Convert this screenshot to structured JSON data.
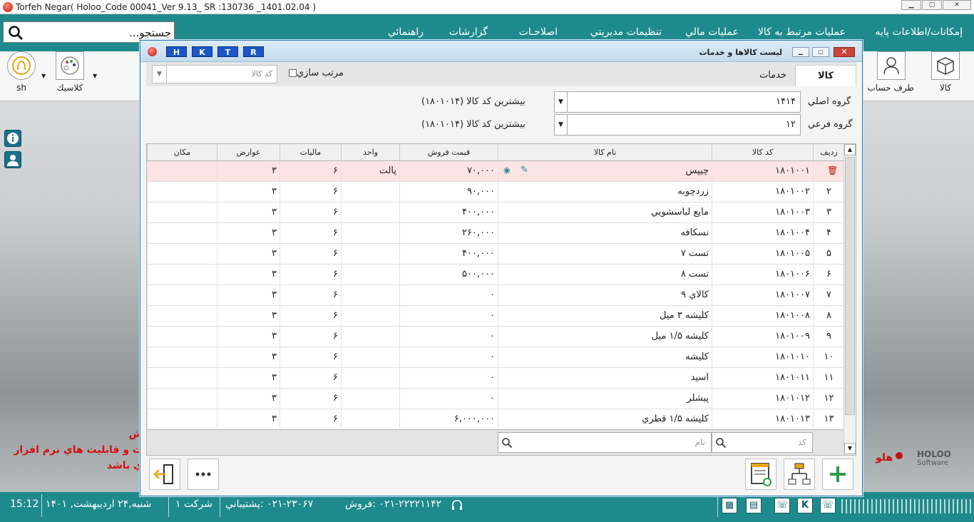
{
  "app": {
    "title": "Torfeh Negar( Holoo_Code  00041_Ver 9.13_ SR :130736 _1401.02.04 )",
    "search_text": "جستجو..."
  },
  "menu": [
    "إمكانات/اطلاعات پايه",
    "عمليات مرتبط به كالا",
    "عمليات مالي",
    "تنظيمات مديريتي",
    "اصلاحـات",
    "گزارشات",
    "راهنمائي"
  ],
  "toolbar": {
    "kala": "كالا",
    "taraf_hesab": "طرف حساب",
    "classic": "كلاسيك",
    "sh": "sh"
  },
  "promo": {
    "line1": "ش",
    "line2": "ت و قابليت هاي نرم افزار",
    "line3": "ي باشد"
  },
  "holoo": {
    "brand": "HOLOO",
    "sub": "Software",
    "fa": "هلو"
  },
  "status": {
    "time": "15:12",
    "date": "شنبه,۲۴ ارديبهشت, ۱۴۰۱",
    "company": "شركت ۱",
    "support": "۰۲۱-۲۳۰۶۷ :پشتيباني",
    "sales": "۰۲۱-۲۲۲۲۱۱۴۲ :فروش",
    "k_label": "K"
  },
  "dialog": {
    "title": "ليست كالاها و خدمات",
    "hktr": [
      "H",
      "K",
      "T",
      "R"
    ],
    "tabs": {
      "kala": "كالا",
      "khadamat": "خدمات"
    },
    "sort_label": "مرتب سازي",
    "search_placeholder": "كد كالا",
    "group_main_label": "گروه اصلي",
    "group_main_value": "۱۴۱۴",
    "group_sub_label": "گروه فرعي",
    "group_sub_value": "۱۲",
    "max_code_1": "بيشترين كد كالا (۱۸۰۱۰۱۴)",
    "max_code_2": "بيشترين كد كالا (۱۸۰۱۰۱۴)",
    "footer_search_code": "كد",
    "footer_search_name": "نام"
  },
  "grid": {
    "headers": {
      "row": "رديف",
      "code": "كد كالا",
      "name": "نام كالا",
      "price": "قيمت فروش",
      "unit": "واحد",
      "tax": "ماليات",
      "duty": "عوارض",
      "place": "مكان"
    },
    "rows": [
      {
        "n": "",
        "code": "۱۸۰۱۰۰۱",
        "name": "چيپس",
        "price": "۷۰,۰۰۰",
        "unit": "پالت",
        "tax": "۶",
        "duty": "۳",
        "place": ""
      },
      {
        "n": "۲",
        "code": "۱۸۰۱۰۰۲",
        "name": "زردچوبه",
        "price": "۹۰,۰۰۰",
        "unit": "",
        "tax": "۶",
        "duty": "۳",
        "place": ""
      },
      {
        "n": "۳",
        "code": "۱۸۰۱۰۰۳",
        "name": "مايع لباسشويي",
        "price": "۴۰۰,۰۰۰",
        "unit": "",
        "tax": "۶",
        "duty": "۳",
        "place": ""
      },
      {
        "n": "۴",
        "code": "۱۸۰۱۰۰۴",
        "name": "نسكافه",
        "price": "۲۶۰,۰۰۰",
        "unit": "",
        "tax": "۶",
        "duty": "۳",
        "place": ""
      },
      {
        "n": "۵",
        "code": "۱۸۰۱۰۰۵",
        "name": "تست ۷",
        "price": "۴۰۰,۰۰۰",
        "unit": "",
        "tax": "۶",
        "duty": "۳",
        "place": ""
      },
      {
        "n": "۶",
        "code": "۱۸۰۱۰۰۶",
        "name": "تست ۸",
        "price": "۵۰۰,۰۰۰",
        "unit": "",
        "tax": "۶",
        "duty": "۳",
        "place": ""
      },
      {
        "n": "۷",
        "code": "۱۸۰۱۰۰۷",
        "name": "كالاي ۹",
        "price": "۰",
        "unit": "",
        "tax": "۶",
        "duty": "۳",
        "place": ""
      },
      {
        "n": "۸",
        "code": "۱۸۰۱۰۰۸",
        "name": "كليشه ۳ ميل",
        "price": "۰",
        "unit": "",
        "tax": "۶",
        "duty": "۳",
        "place": ""
      },
      {
        "n": "۹",
        "code": "۱۸۰۱۰۰۹",
        "name": "كليشه ۱/۵ ميل",
        "price": "۰",
        "unit": "",
        "tax": "۶",
        "duty": "۳",
        "place": ""
      },
      {
        "n": "۱۰",
        "code": "۱۸۰۱۰۱۰",
        "name": "كليشه",
        "price": "۰",
        "unit": "",
        "tax": "۶",
        "duty": "۳",
        "place": ""
      },
      {
        "n": "۱۱",
        "code": "۱۸۰۱۰۱۱",
        "name": "اسيد",
        "price": "۰",
        "unit": "",
        "tax": "۶",
        "duty": "۳",
        "place": ""
      },
      {
        "n": "۱۲",
        "code": "۱۸۰۱۰۱۲",
        "name": "پيشلر",
        "price": "۰",
        "unit": "",
        "tax": "۶",
        "duty": "۳",
        "place": ""
      },
      {
        "n": "۱۳",
        "code": "۱۸۰۱۰۱۳",
        "name": "كليشه ۱/۵ قطري",
        "price": "۶,۰۰۰,۰۰۰",
        "unit": "",
        "tax": "۶",
        "duty": "۳",
        "place": ""
      }
    ]
  },
  "colors": {
    "accent": "#1f8a8c",
    "selected_row": "#fde4e4",
    "hktr_blue": "#1b57c7"
  }
}
